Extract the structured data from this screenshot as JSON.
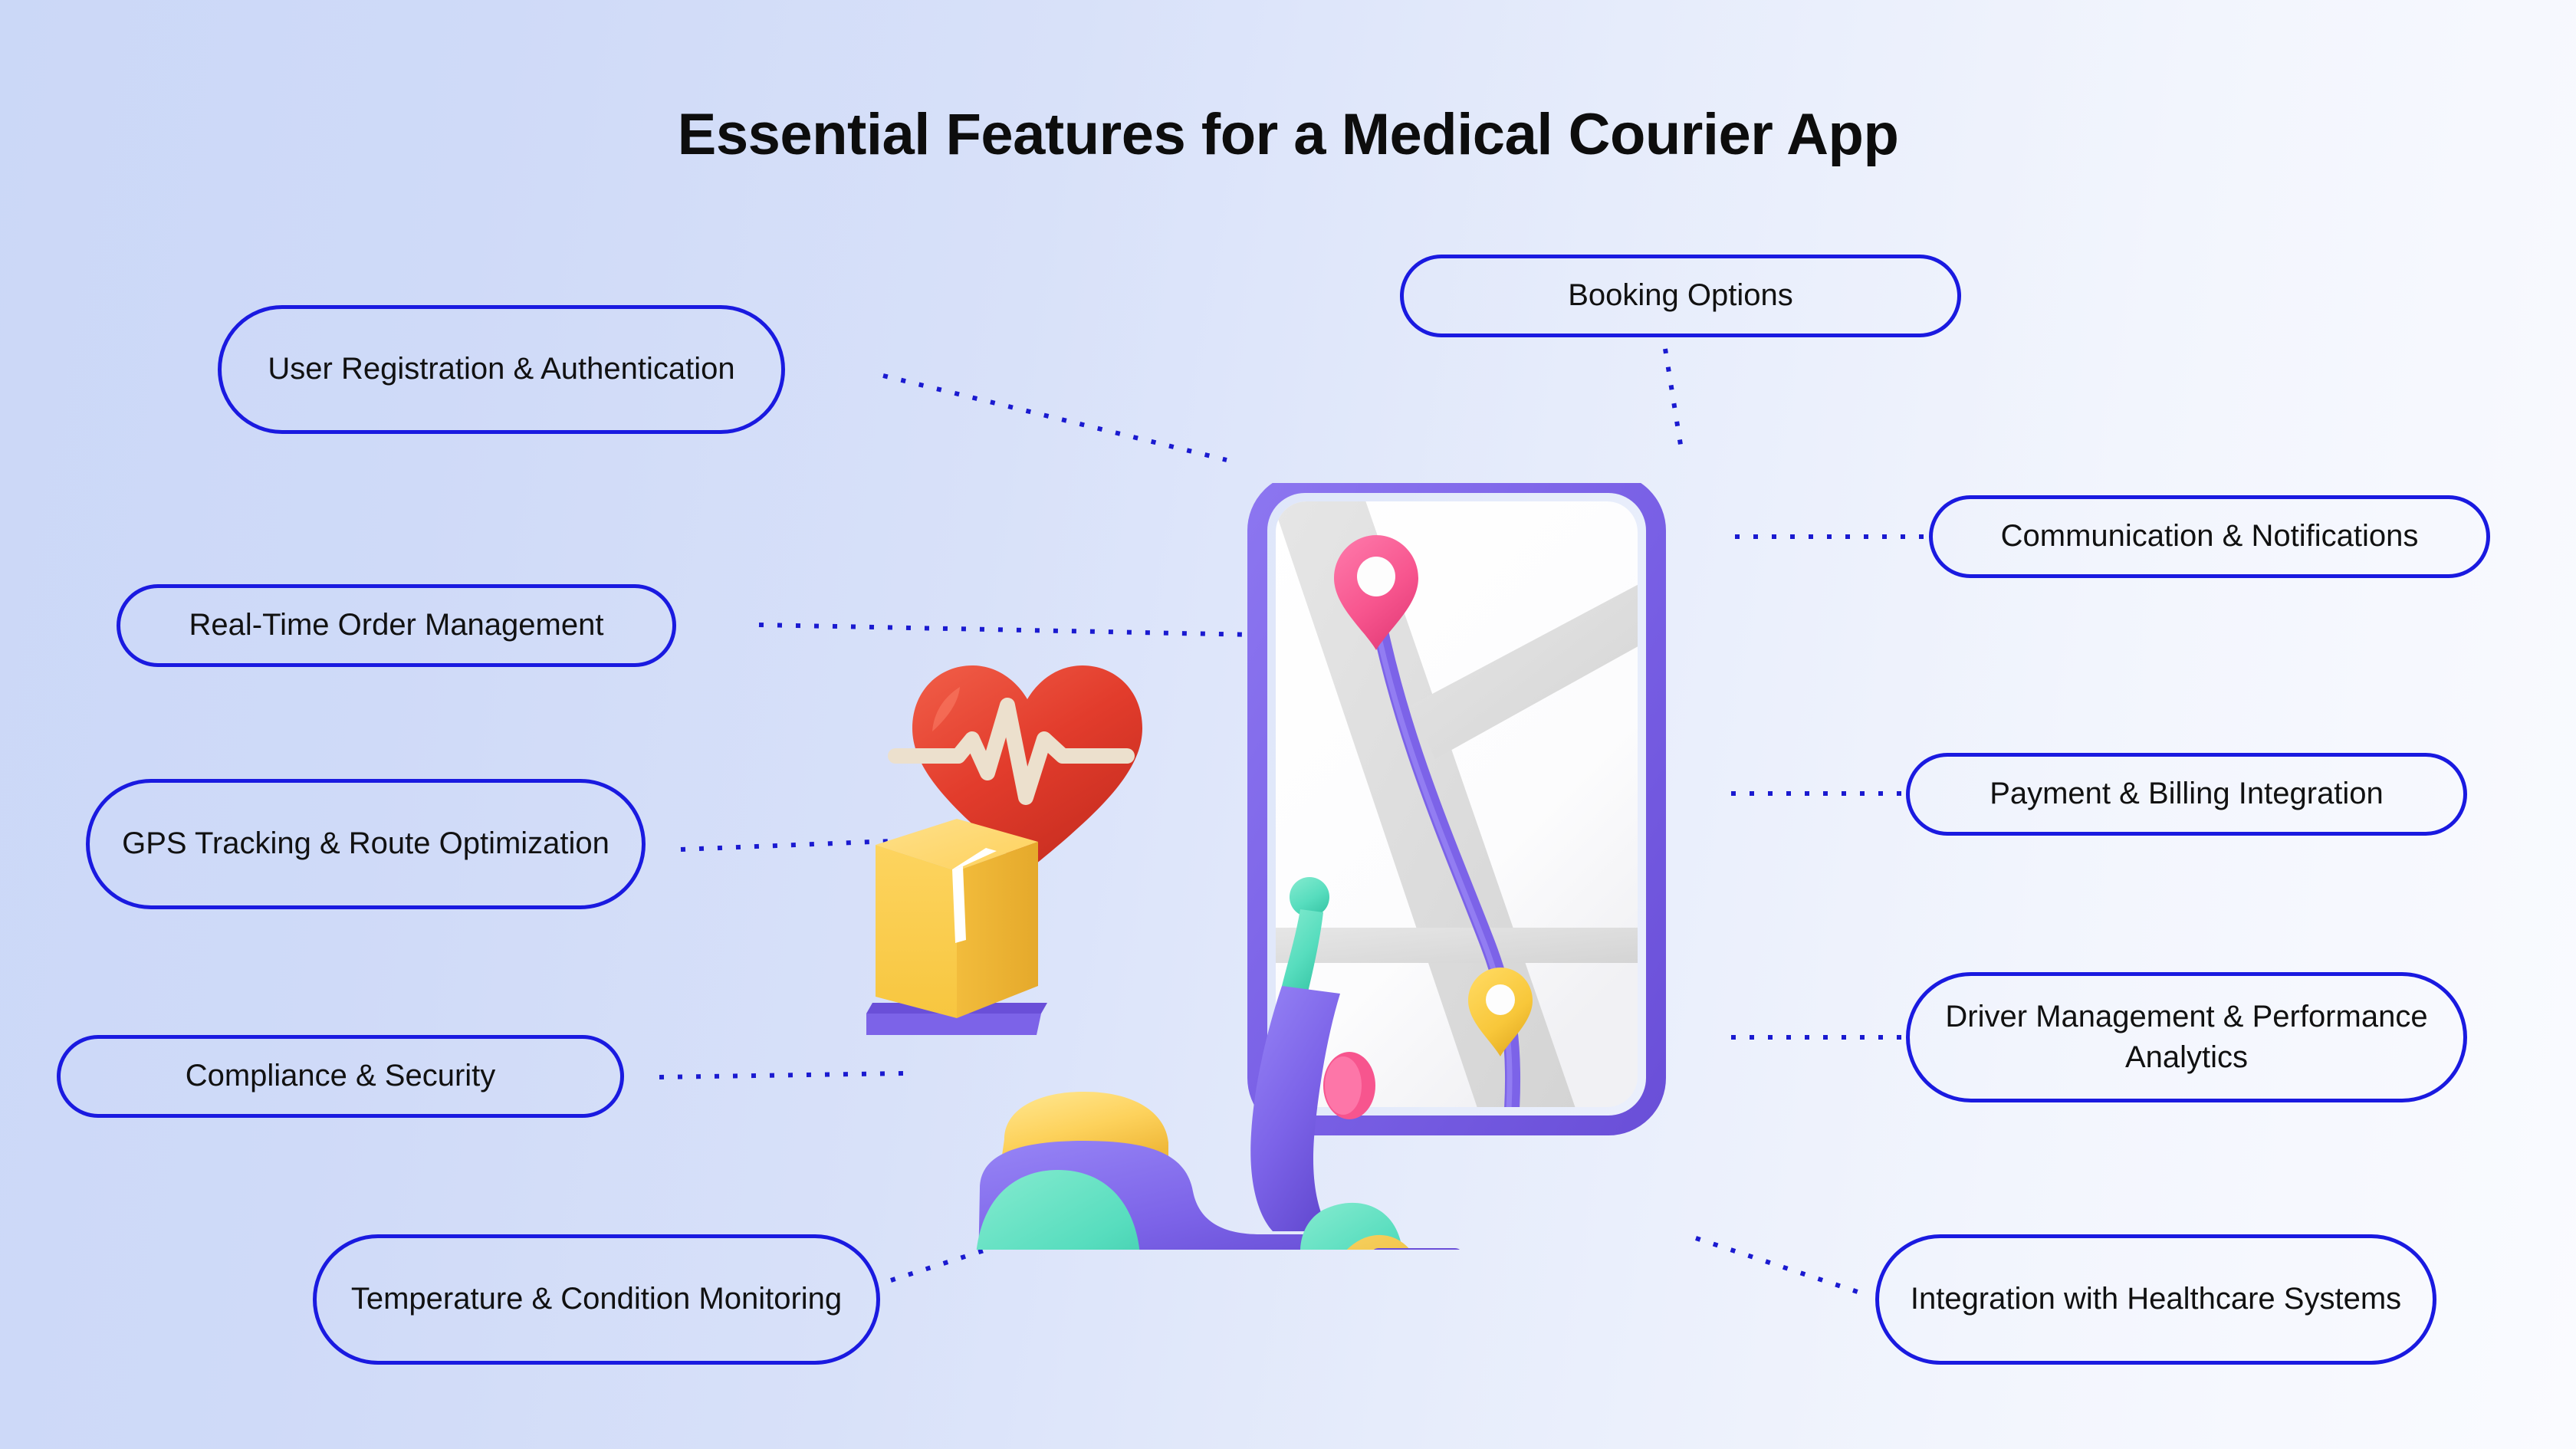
{
  "page": {
    "title": "Essential Features for a Medical Courier App",
    "background_gradient_from": "#cbd8f7",
    "background_gradient_to": "#fafbff"
  },
  "theme": {
    "pill_border_color": "#1a1ae0",
    "pill_text_color": "#111111",
    "connector_color": "#1a1ad0",
    "title_color": "#0d0d0d",
    "phone_frame_color": "#7c63e8",
    "map_road_color": "#e0e0e0",
    "map_screen_color": "#ffffff",
    "pin_pink_color": "#f7558e",
    "pin_yellow_color": "#f8c73a",
    "heart_color": "#e13b2e",
    "ekg_line_color": "#ece0cd",
    "package_color": "#fcd45f",
    "scooter_body_color": "#7c63e8",
    "scooter_fender_color": "#5ee0c0",
    "scooter_wheel_color": "#f0bc3f",
    "scooter_seat_color": "#fcd45f",
    "mirror_color": "#f7558e",
    "handlebar_color": "#3ed9b4"
  },
  "features": {
    "left": [
      {
        "id": "user-registration-authentication",
        "label": "User Registration & Authentication"
      },
      {
        "id": "real-time-order-management",
        "label": "Real-Time Order Management"
      },
      {
        "id": "gps-tracking-route-optimization",
        "label": "GPS Tracking & Route Optimization"
      },
      {
        "id": "compliance-security",
        "label": "Compliance & Security"
      },
      {
        "id": "temperature-condition-monitoring",
        "label": "Temperature & Condition Monitoring"
      }
    ],
    "right": [
      {
        "id": "booking-options",
        "label": "Booking Options"
      },
      {
        "id": "communication-notifications",
        "label": "Communication & Notifications"
      },
      {
        "id": "payment-billing-integration",
        "label": "Payment & Billing Integration"
      },
      {
        "id": "driver-management-performance-analytics",
        "label": "Driver Management & Performance Analytics"
      },
      {
        "id": "integration-with-healthcare-systems",
        "label": "Integration with Healthcare Systems"
      }
    ]
  },
  "illustration": {
    "name": "medical-courier-3d-illustration",
    "elements": [
      "smartphone-map",
      "route-line",
      "pink-map-pin",
      "yellow-map-pin",
      "heartbeat-heart",
      "package-box",
      "delivery-scooter"
    ]
  }
}
